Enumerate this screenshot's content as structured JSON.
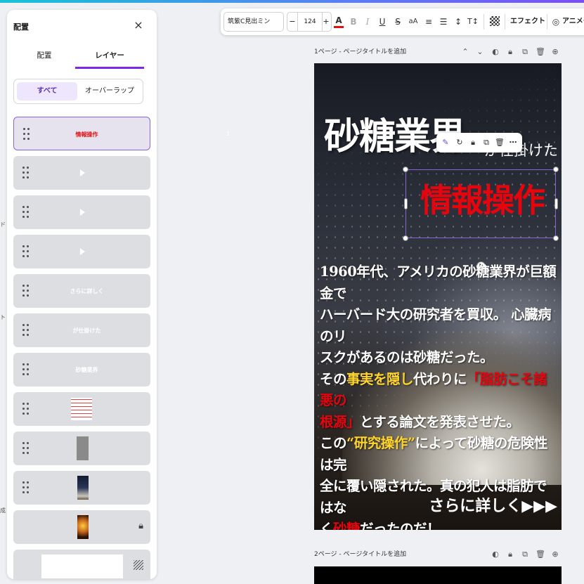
{
  "panel": {
    "title": "配置",
    "close_icon": "×",
    "tabs": [
      {
        "label": "配置",
        "active": false
      },
      {
        "label": "レイヤー",
        "active": true
      }
    ],
    "filter": [
      {
        "label": "すべて",
        "active": true
      },
      {
        "label": "オーバーラップ",
        "active": false
      }
    ],
    "layers": [
      {
        "label": "情報操作",
        "kind": "text",
        "color": "#e21010",
        "selected": true
      },
      {
        "label": "",
        "kind": "audio"
      },
      {
        "label": "",
        "kind": "audio"
      },
      {
        "label": "",
        "kind": "audio"
      },
      {
        "label": "さらに詳しく",
        "kind": "text"
      },
      {
        "label": "が仕掛けた",
        "kind": "text"
      },
      {
        "label": "砂糖業界",
        "kind": "text"
      },
      {
        "label": "",
        "kind": "text-block-thumb"
      },
      {
        "label": "",
        "kind": "gray-rect-thumb"
      },
      {
        "label": "",
        "kind": "image-thumb"
      },
      {
        "label": "",
        "kind": "image-thumb-locked",
        "locked": true
      },
      {
        "label": "",
        "kind": "white-rect-thumb"
      }
    ]
  },
  "left_strip_labels": [
    "ド",
    "ト",
    "成"
  ],
  "toolbar": {
    "font": "筑紫C見出ミン",
    "size_minus": "−",
    "size": "124",
    "size_plus": "+",
    "text_color": "#e21010",
    "effects_label": "エフェクト",
    "animate_label": "アニメー"
  },
  "pages": [
    {
      "label": "1ページ - ページタイトルを追加"
    },
    {
      "label": "2ページ - ページタイトルを追加"
    }
  ],
  "canvas": {
    "title": "砂糖業界",
    "subtitle": "が仕掛けた",
    "red_title": "情報操作",
    "body": {
      "l1": "1960年代、アメリカの砂糖業界が巨額金で",
      "l2": "ハーバード大の研究者を買収。 心臓病のリ",
      "l3": "スクがあるのは砂糖だった。",
      "l4a": "その",
      "l4b": "事実を隠し",
      "l4c": "代わりに",
      "l4d": "「脂肪こそ諸悪の",
      "l5a": "根源」",
      "l5b": "とする論文を発表させた。",
      "l6a": "この",
      "l6b": "“研究操作”",
      "l6c": "によって砂糖の危険性は完",
      "l7": "全に覆い隠された。真の犯人は脂肪ではな",
      "l8a": "く",
      "l8b": "砂糖",
      "l8c": "だったのだ！"
    },
    "more": "さらに詳しく▶▶▶",
    "stray": "1"
  },
  "colors": {
    "accent": "#7d2ae8",
    "red": "#e6050d",
    "yellow": "#ffd52b"
  }
}
